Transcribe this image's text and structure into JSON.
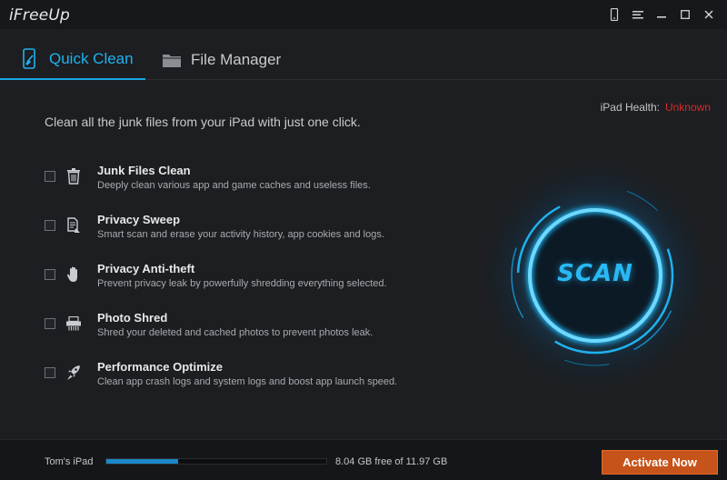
{
  "app": {
    "title": "iFreeUp"
  },
  "titlebar": {
    "icons": [
      "phone-icon",
      "menu-icon",
      "minimize-icon",
      "maximize-icon",
      "close-icon"
    ]
  },
  "tabs": [
    {
      "label": "Quick Clean",
      "icon": "phone-broom-icon",
      "active": true
    },
    {
      "label": "File Manager",
      "icon": "folder-icon",
      "active": false
    }
  ],
  "health": {
    "label": "iPad Health:",
    "value": "Unknown",
    "value_color": "#d62b2b"
  },
  "intro": "Clean all the junk files from your iPad with just one click.",
  "options": [
    {
      "title": "Junk Files Clean",
      "desc": "Deeply clean various app and game caches and useless files.",
      "icon": "trash-icon",
      "checked": false
    },
    {
      "title": "Privacy Sweep",
      "desc": "Smart scan and erase your activity history, app cookies and logs.",
      "icon": "document-sweep-icon",
      "checked": false
    },
    {
      "title": "Privacy Anti-theft",
      "desc": "Prevent privacy leak by powerfully shredding everything selected.",
      "icon": "hand-icon",
      "checked": false
    },
    {
      "title": "Photo Shred",
      "desc": "Shred your deleted and cached photos to prevent photos leak.",
      "icon": "shredder-icon",
      "checked": false
    },
    {
      "title": "Performance Optimize",
      "desc": "Clean app crash logs and system logs and boost app launch speed.",
      "icon": "rocket-icon",
      "checked": false
    }
  ],
  "scan": {
    "label": "SCAN",
    "accent": "#1fb2ee"
  },
  "footer": {
    "device": "Tom's iPad",
    "storage_text": "8.04 GB free of 11.97 GB",
    "used_fraction": 0.328,
    "activate_label": "Activate Now",
    "activate_color": "#c6541a"
  }
}
